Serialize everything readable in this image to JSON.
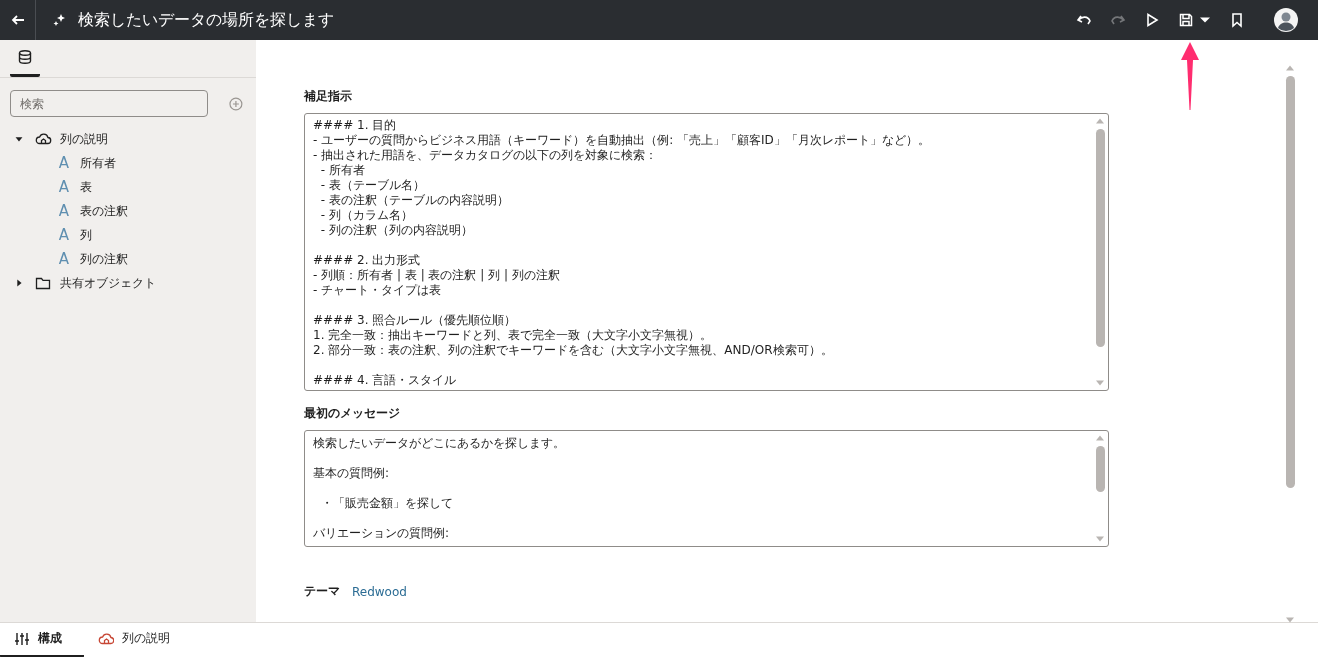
{
  "header": {
    "title": "検索したいデータの場所を探します",
    "actions": [
      {
        "kind": "undo",
        "disabled": false
      },
      {
        "kind": "redo",
        "disabled": true
      },
      {
        "kind": "run",
        "disabled": false
      },
      {
        "kind": "save",
        "disabled": false
      },
      {
        "kind": "dropdown",
        "disabled": false
      },
      {
        "kind": "bookmark",
        "disabled": false
      }
    ]
  },
  "sidebar": {
    "tabs": [
      {
        "kind": "data",
        "selected": true
      }
    ],
    "search": {
      "placeholder": "検索"
    },
    "tree": [
      {
        "label": "列の説明",
        "kind": "cloud",
        "expanded": true,
        "children": [
          {
            "label": "所有者",
            "kind": "attribute",
            "icon": "A"
          },
          {
            "label": "表",
            "kind": "attribute",
            "icon": "A"
          },
          {
            "label": "表の注釈",
            "kind": "attribute",
            "icon": "A"
          },
          {
            "label": "列",
            "kind": "attribute",
            "icon": "A"
          },
          {
            "label": "列の注釈",
            "kind": "attribute",
            "icon": "A"
          }
        ]
      },
      {
        "label": "共有オブジェクト",
        "kind": "folder",
        "expanded": false
      }
    ]
  },
  "form": {
    "fields": [
      {
        "label": "補足指示",
        "paragraphs": [
          [
            "#### 1. 目的",
            "- ユーザーの質問からビジネス用語（キーワード）を自動抽出（例: 「売上」「顧客ID」「月次レポート」など）。",
            "- 抽出された用語を、データカタログの以下の列を対象に検索：",
            "  - 所有者",
            "  - 表（テーブル名）",
            "  - 表の注釈（テーブルの内容説明）",
            "  - 列（カラム名）",
            "  - 列の注釈（列の内容説明）"
          ],
          [
            "#### 2. 出力形式",
            "- 列順：所有者 | 表 | 表の注釈 | 列 | 列の注釈",
            "- チャート・タイプは表"
          ],
          [
            "#### 3. 照合ルール（優先順位順）",
            "1. 完全一致：抽出キーワードと列、表で完全一致（大文字小文字無視）。",
            "2. 部分一致：表の注釈、列の注釈でキーワードを含む（大文字小文字無視、AND/OR検索可）。"
          ],
          [
            "#### 4. 言語・スタイル"
          ]
        ]
      },
      {
        "label": "最初のメッセージ",
        "paragraphs": [
          [
            "検索したいデータがどこにあるかを探します。"
          ],
          [
            "基本の質問例:"
          ],
          [
            "  ・「販売金額」を探して"
          ],
          [
            "バリエーションの質問例:"
          ]
        ]
      }
    ],
    "theme": {
      "label": "テーマ",
      "value": "Redwood"
    }
  },
  "bottom_tabs": [
    {
      "label": "構成",
      "kind": "settings",
      "selected": true
    },
    {
      "label": "列の説明",
      "kind": "cloud",
      "selected": false
    }
  ],
  "annotations": [
    {
      "kind": "arrow",
      "color": "#ff2d6f"
    }
  ]
}
